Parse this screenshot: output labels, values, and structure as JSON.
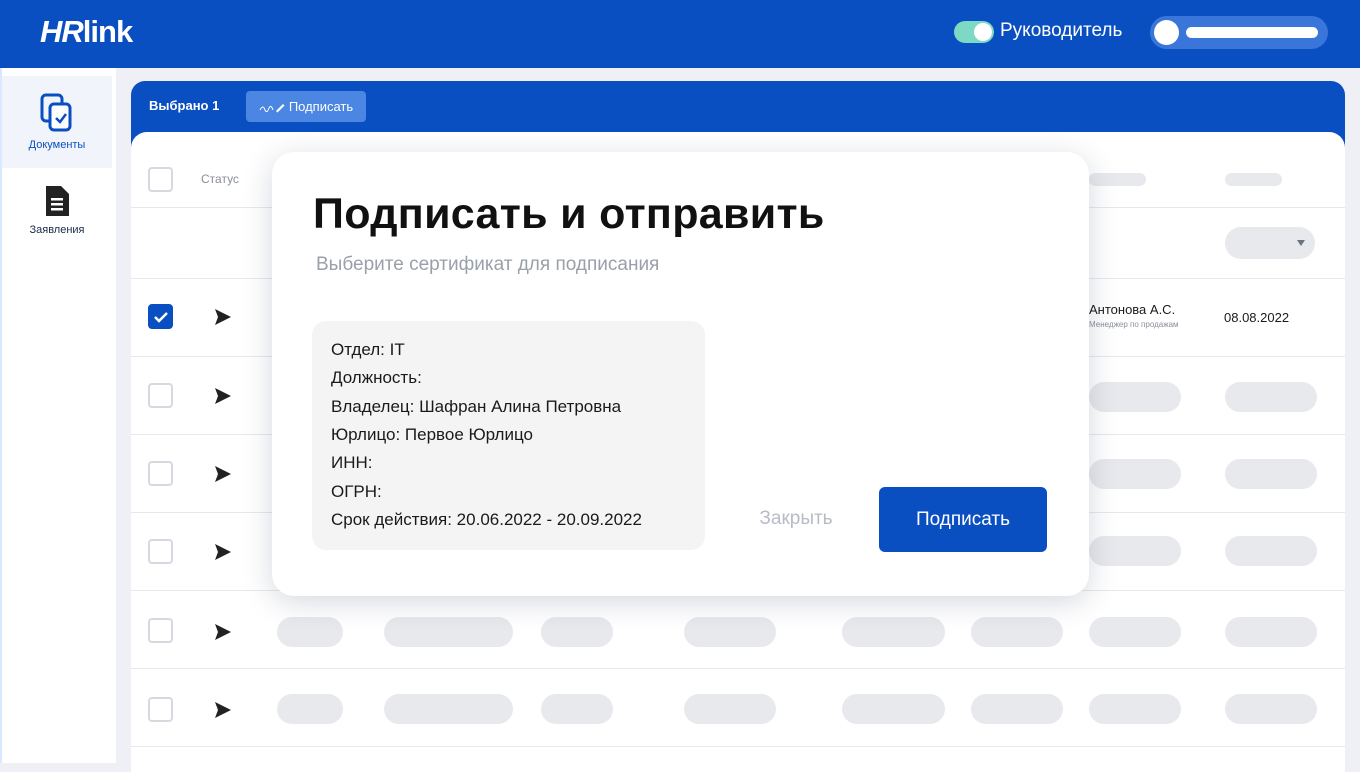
{
  "header": {
    "logo_hr": "HR",
    "logo_link": "link",
    "role_label": "Руководитель",
    "role_toggle_on": true
  },
  "sidebar": {
    "items": [
      {
        "label": "Документы",
        "icon": "documents-icon",
        "active": true
      },
      {
        "label": "Заявления",
        "icon": "file-text-icon",
        "active": false
      }
    ]
  },
  "selection_bar": {
    "selected_label": "Выбрано 1",
    "sign_label": "Подписать"
  },
  "table": {
    "status_header": "Статус",
    "selected_row": {
      "name": "Антонова А.С.",
      "role": "Менеджер по продажам",
      "date": "08.08.2022"
    }
  },
  "modal": {
    "title": "Подписать и отправить",
    "subtitle": "Выберите сертификат для подписания",
    "certificate": {
      "department": "Отдел: IT",
      "position": "Должность:",
      "owner": "Владелец: Шафран Алина Петровна",
      "entity": "Юрлицо: Первое Юрлицо",
      "inn": "ИНН:",
      "ogrn": "ОГРН:",
      "validity": "Срок действия: 20.06.2022 - 20.09.2022"
    },
    "close_label": "Закрыть",
    "sign_label": "Подписать"
  },
  "colors": {
    "brand_blue": "#0a4fc1",
    "toggle_green": "#7ed9c4"
  }
}
